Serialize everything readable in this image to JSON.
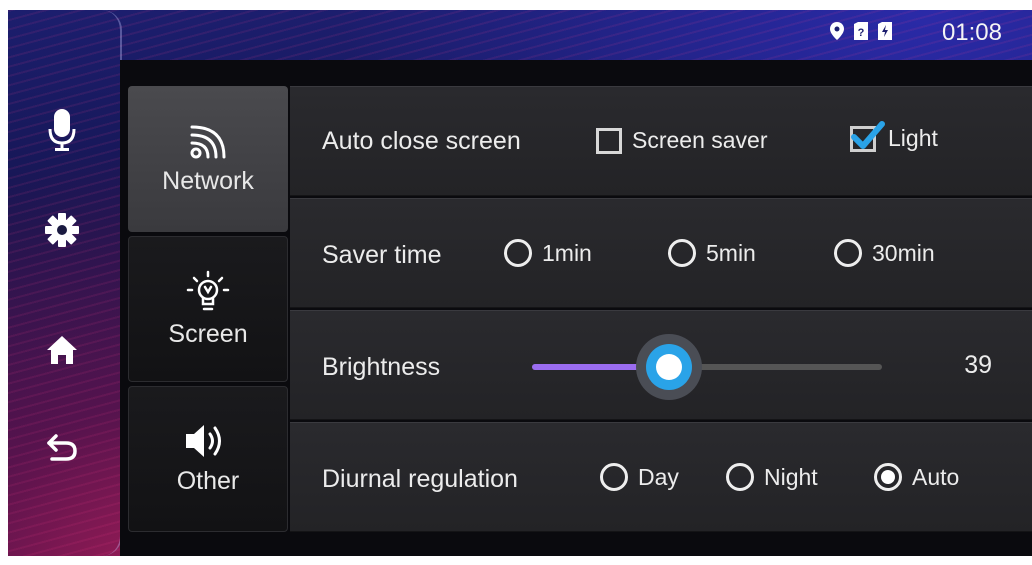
{
  "status": {
    "time": "01:08",
    "icons": [
      "location-icon",
      "sim1-icon",
      "sim2-icon"
    ]
  },
  "nav": {
    "items": [
      {
        "name": "microphone-icon"
      },
      {
        "name": "settings-icon"
      },
      {
        "name": "home-icon"
      },
      {
        "name": "back-icon"
      }
    ]
  },
  "tabs": [
    {
      "label": "Network",
      "icon": "wifi-icon",
      "active": true
    },
    {
      "label": "Screen",
      "icon": "bulb-icon",
      "active": false
    },
    {
      "label": "Other",
      "icon": "speaker-icon",
      "active": false
    }
  ],
  "settings": {
    "auto_close": {
      "label": "Auto close screen",
      "options": [
        {
          "label": "Screen saver",
          "checked": false
        },
        {
          "label": "Light",
          "checked": true
        }
      ]
    },
    "saver_time": {
      "label": "Saver time",
      "options": [
        {
          "label": "1min",
          "selected": false
        },
        {
          "label": "5min",
          "selected": false
        },
        {
          "label": "30min",
          "selected": false
        }
      ]
    },
    "brightness": {
      "label": "Brightness",
      "value": "39",
      "min": 0,
      "max": 100
    },
    "diurnal": {
      "label": "Diurnal regulation",
      "options": [
        {
          "label": "Day",
          "selected": false
        },
        {
          "label": "Night",
          "selected": false
        },
        {
          "label": "Auto",
          "selected": true
        }
      ]
    }
  },
  "colors": {
    "accent_fill": "#9a6cf0",
    "thumb": "#2aa3e8",
    "check": "#2aa3e8"
  }
}
